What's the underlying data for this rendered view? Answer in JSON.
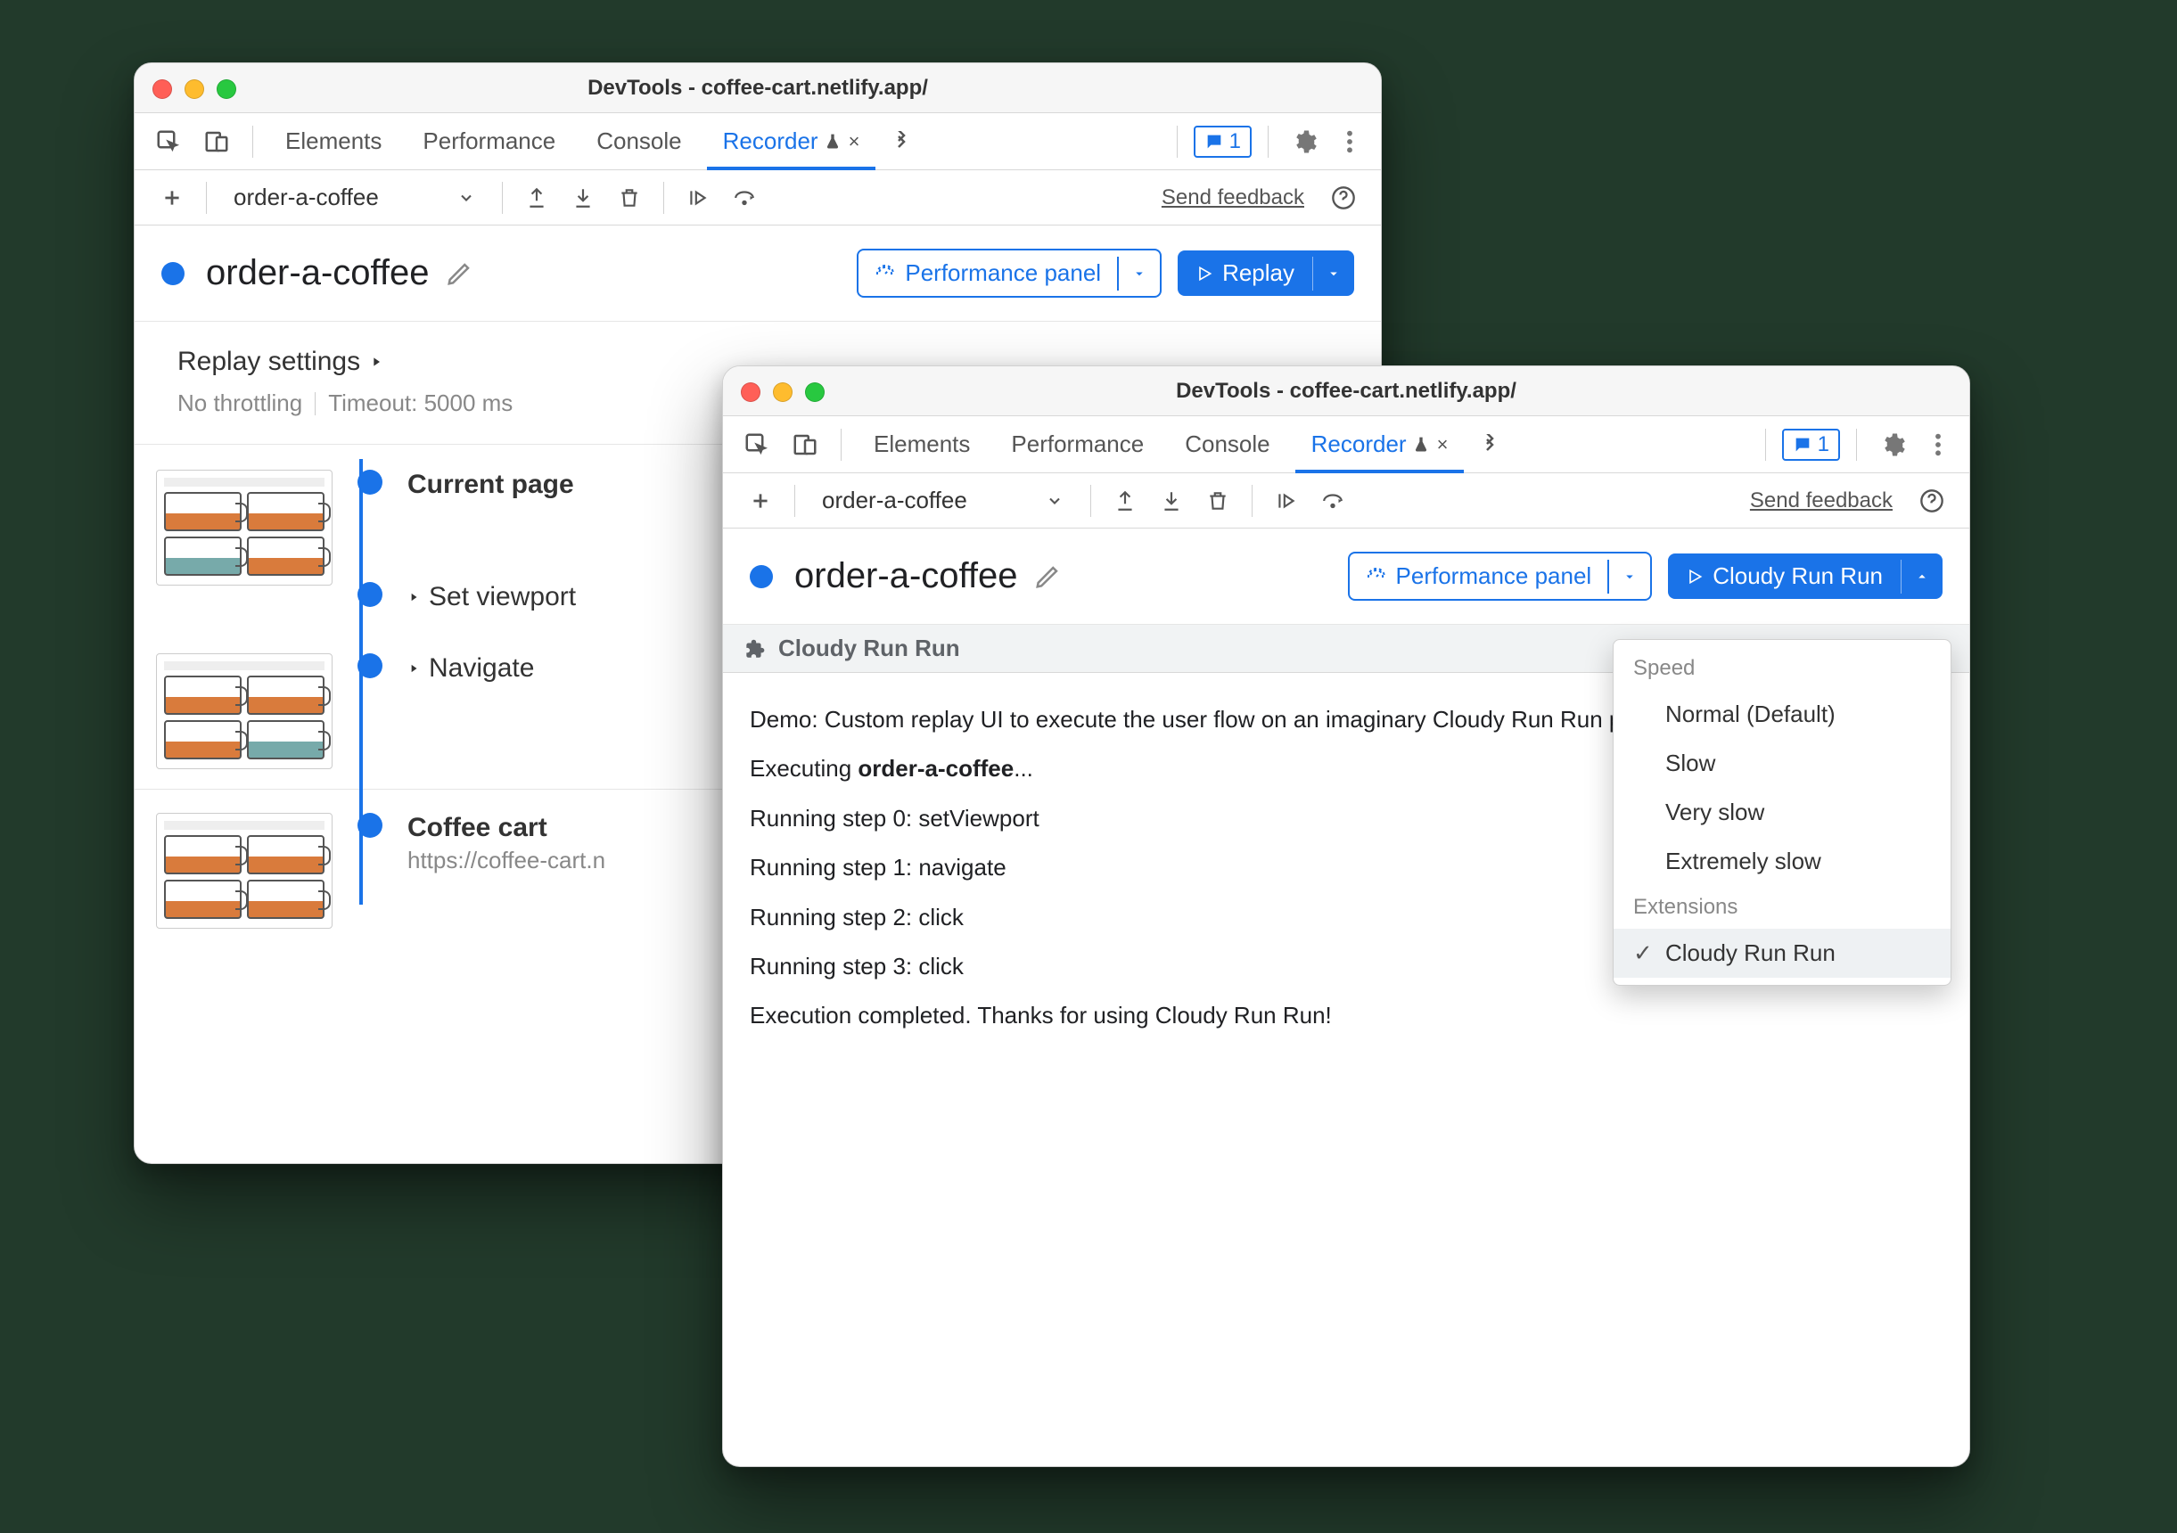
{
  "window1": {
    "title": "DevTools - coffee-cart.netlify.app/",
    "tabs": [
      "Elements",
      "Performance",
      "Console",
      "Recorder"
    ],
    "active_tab": "Recorder",
    "issues_count": "1",
    "recording_name": "order-a-coffee",
    "feedback_label": "Send feedback",
    "perf_panel_label": "Performance panel",
    "replay_label": "Replay",
    "replay_settings_label": "Replay settings",
    "throttling_text": "No throttling",
    "timeout_text": "Timeout: 5000 ms",
    "steps": [
      {
        "title": "Current page",
        "bold": true
      },
      {
        "title": "Set viewport",
        "bold": false
      },
      {
        "title": "Navigate",
        "bold": false
      },
      {
        "title": "Coffee cart",
        "bold": true,
        "sub": "https://coffee-cart.n"
      }
    ]
  },
  "window2": {
    "title": "DevTools - coffee-cart.netlify.app/",
    "tabs": [
      "Elements",
      "Performance",
      "Console",
      "Recorder"
    ],
    "active_tab": "Recorder",
    "issues_count": "1",
    "recording_name": "order-a-coffee",
    "feedback_label": "Send feedback",
    "perf_panel_label": "Performance panel",
    "replay_label": "Cloudy Run Run",
    "extension_bar_label": "Cloudy Run Run",
    "console_lines": [
      {
        "text": "Demo: Custom replay UI to execute the user flow on an imaginary Cloudy Run Run platform."
      },
      {
        "prefix": "Executing ",
        "bold": "order-a-coffee",
        "suffix": "..."
      },
      {
        "text": "Running step 0: setViewport"
      },
      {
        "text": "Running step 1: navigate"
      },
      {
        "text": "Running step 2: click"
      },
      {
        "text": "Running step 3: click"
      },
      {
        "text": "Execution completed. Thanks for using Cloudy Run Run!"
      }
    ],
    "dropdown": {
      "group1_label": "Speed",
      "speeds": [
        "Normal (Default)",
        "Slow",
        "Very slow",
        "Extremely slow"
      ],
      "group2_label": "Extensions",
      "extensions": [
        "Cloudy Run Run"
      ],
      "selected": "Cloudy Run Run"
    }
  }
}
